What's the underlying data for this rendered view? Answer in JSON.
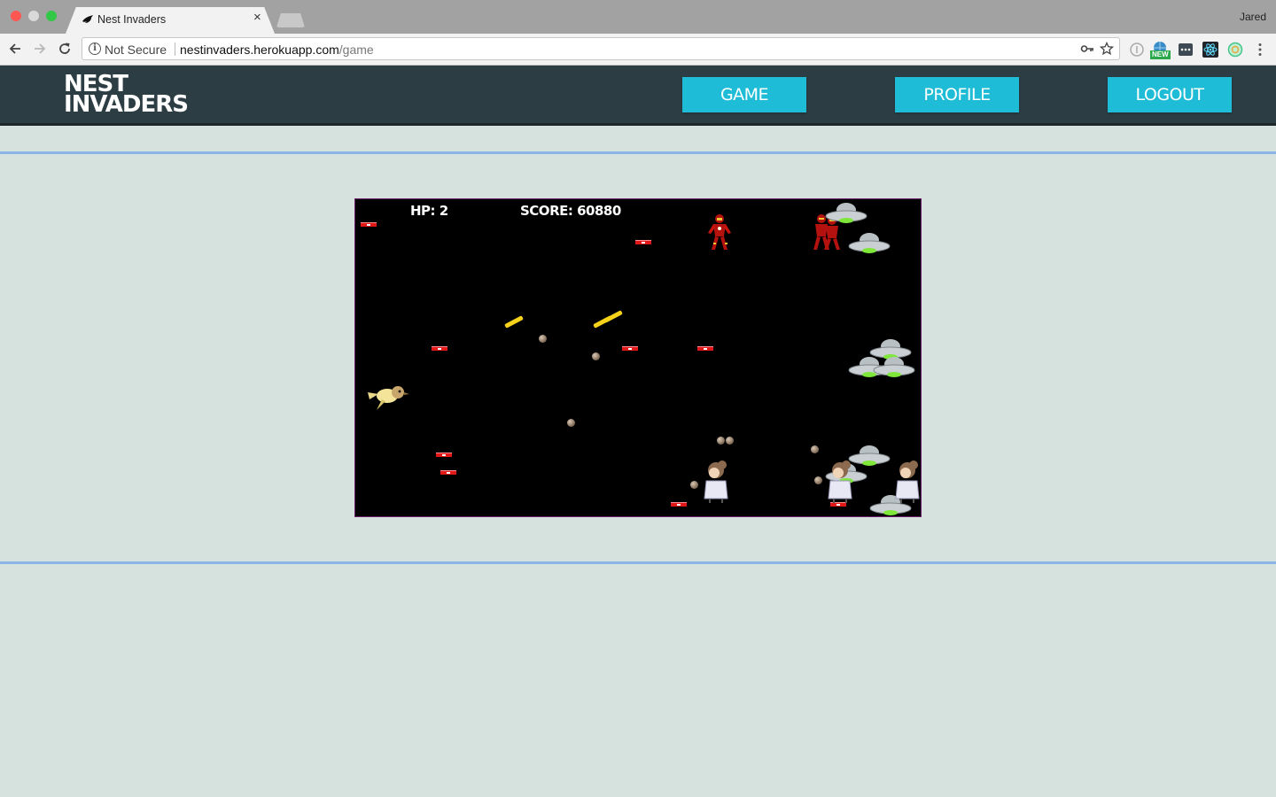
{
  "browser": {
    "tab_title": "Nest Invaders",
    "security_label": "Not Secure",
    "url_host": "nestinvaders.herokuapp.com",
    "url_path": "/game",
    "profile_name": "Jared",
    "extension_badge": "NEW"
  },
  "header": {
    "logo_line1": "NEST",
    "logo_line2": "INVADERS",
    "nav": {
      "game": "GAME",
      "profile": "PROFILE",
      "logout": "LOGOUT"
    }
  },
  "game": {
    "hp_label": "HP: 2",
    "score_label": "SCORE: 60880"
  },
  "colors": {
    "header_bg": "#2d3d44",
    "nav_button": "#1ebcd6",
    "page_bg": "#d6e2de",
    "section_border": "#8bb5e8"
  }
}
